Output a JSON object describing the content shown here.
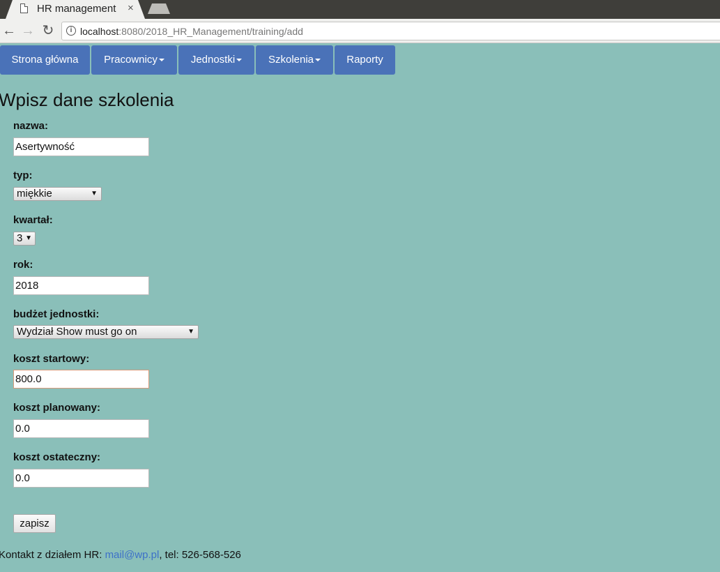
{
  "browser": {
    "tab_title": "HR management",
    "tab_close": "×",
    "url_host": "localhost",
    "url_rest": ":8080/2018_HR_Management/training/add",
    "info_glyph": "i",
    "back_glyph": "←",
    "forward_glyph": "→",
    "reload_glyph": "↻"
  },
  "nav": {
    "home": "Strona główna",
    "employees": "Pracownicy",
    "units": "Jednostki",
    "trainings": "Szkolenia",
    "reports": "Raporty"
  },
  "form": {
    "heading": "Wpisz dane szkolenia",
    "name_label": "nazwa:",
    "name_value": "Asertywność",
    "type_label": "typ:",
    "type_value": "miękkie",
    "quarter_label": "kwartał:",
    "quarter_value": "3",
    "year_label": "rok:",
    "year_value": "2018",
    "budget_label": "budżet jednostki:",
    "budget_value": "Wydział Show must go on",
    "start_cost_label": "koszt startowy:",
    "start_cost_value": "800.0",
    "planned_cost_label": "koszt planowany:",
    "planned_cost_value": "0.0",
    "final_cost_label": "koszt ostateczny:",
    "final_cost_value": "0.0",
    "submit_label": "zapisz",
    "select_arrow": "▼"
  },
  "footer": {
    "prefix": "Kontakt z działem HR: ",
    "email": "mail@wp.pl",
    "suffix": ", tel: 526-568-526"
  }
}
